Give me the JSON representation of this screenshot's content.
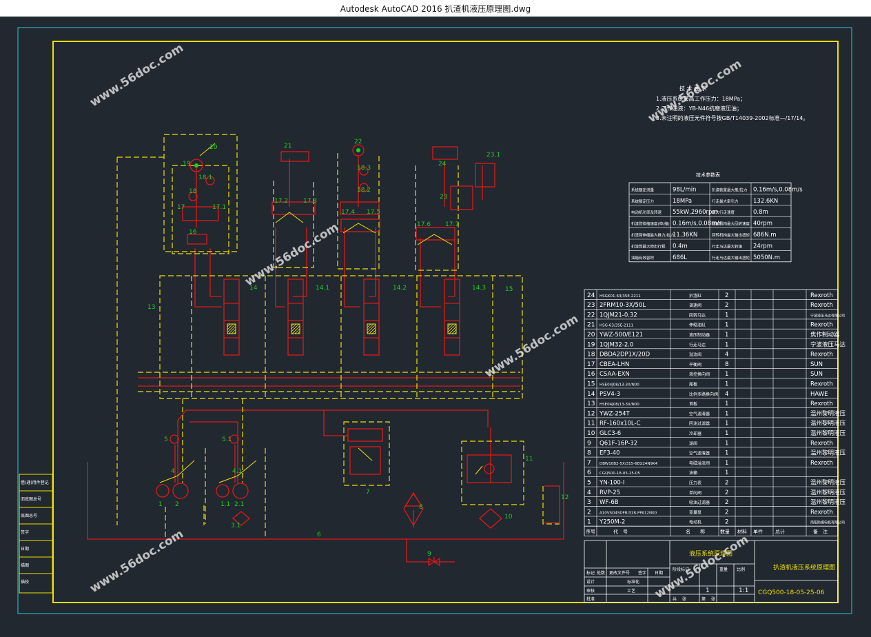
{
  "window": {
    "title": "Autodesk AutoCAD 2016    扒渣机液压原理图.dwg"
  },
  "watermark": "www.56doc.com",
  "callouts": {
    "c20": "20",
    "c19": "19",
    "c18_1": "18.1",
    "c18": "18",
    "c17": "17",
    "c17_1": "17.1",
    "c16": "16",
    "c21": "21",
    "c17_2": "17.2",
    "c17_3": "17.3",
    "c22": "22",
    "c18_3": "18.3",
    "c18_2": "18.2",
    "c17_4": "17.4",
    "c17_5": "17.5",
    "c24": "24",
    "c23_1": "23.1",
    "c23": "23",
    "c17_6": "17.6",
    "c17_7": "17.7",
    "c13": "13",
    "c14": "14",
    "c14_1": "14.1",
    "c14_2": "14.2",
    "c14_3": "14.3",
    "c15": "15",
    "c5": "5",
    "c5_1": "5.1",
    "c4": "4",
    "c4_1": "4.1",
    "c1": "1",
    "c2": "2",
    "c1_1": "1.1",
    "c2_1": "2.1",
    "c3_1": "3.1",
    "c6": "6",
    "c7": "7",
    "c8": "8",
    "c9": "9",
    "c10": "10",
    "c11": "11",
    "c12": "12"
  },
  "tech_req": {
    "title": "技 术 要 求",
    "l1": "1.液压系统最高工作压力：18MPa；",
    "l2": "2.工作油液：YB-N46抗磨液压油；",
    "l3": "3.未注明的液压元件符号按GB/T14039-2002标准—/17/14。"
  },
  "param_table": {
    "title": "技术参数表",
    "rows": [
      [
        "系统额定流量",
        "98L/min",
        "扒渣装置最大推/拉力",
        "0.16m/s,0.08m/s"
      ],
      [
        "系统额定压力",
        "18MPa",
        "行走最大牵引力",
        "132.6KN"
      ],
      [
        "电动机功率及转速",
        "55kW,2960rpm",
        "最大行走速度",
        "0.8m"
      ],
      [
        "扒渣臂伸缩速度(伸/缩)",
        "0.16m/s,0.08m/s",
        "回转机构最大回转速度",
        "40rpm"
      ],
      [
        "扒渣臂伸缩最大推力/拉力",
        "11.36KN",
        "回转机构最大输出扭矩",
        "686N.m"
      ],
      [
        "扒渣臂最大伸出行程",
        "0.4m",
        "行走马达最大转速",
        "24rpm"
      ],
      [
        "油箱有效容积",
        "686L",
        "行走马达最大输出扭矩",
        "5050N.m"
      ]
    ]
  },
  "bom": {
    "rows": [
      [
        "24",
        "HSGK01-63/35E-2211",
        "扒渣缸",
        "2",
        "Rexroth"
      ],
      [
        "23",
        "2FRM10-3X/50L",
        "调速阀",
        "2",
        "Rexroth"
      ],
      [
        "22",
        "1QJM21-0.32",
        "回转马达",
        "1",
        "宁波液压马达有限公司"
      ],
      [
        "21",
        "HSG-63/35E-2111",
        "伸缩油缸",
        "1",
        "Rexroth"
      ],
      [
        "20",
        "YWZ-500/E121",
        "液压制动器",
        "1",
        "焦作制动器"
      ],
      [
        "19",
        "1QJM32-2.0",
        "行走马达",
        "1",
        "宁波液压马达"
      ],
      [
        "18",
        "DBDA2DP1X/20D",
        "溢流阀",
        "4",
        "Rexroth"
      ],
      [
        "17",
        "CBEA-LHN",
        "平衡阀",
        "8",
        "SUN"
      ],
      [
        "16",
        "CSAA-EXN",
        "液控换向阀",
        "1",
        "SUN"
      ],
      [
        "15",
        "HSE04J08/13-3X/N00",
        "尾板",
        "1",
        "Rexroth"
      ],
      [
        "14",
        "PSV4-3",
        "比例多路换向阀",
        "4",
        "HAWE"
      ],
      [
        "13",
        "HSE04J08/13-3X/N00",
        "首板",
        "1",
        "Rexroth"
      ],
      [
        "12",
        "YWZ-254T",
        "空气滤清器",
        "1",
        "温州黎明液压"
      ],
      [
        "11",
        "RF-160x10L-C",
        "回油过滤器",
        "1",
        "温州黎明液压"
      ],
      [
        "10",
        "GLC3-6",
        "冷却器",
        "1",
        "温州黎明液压"
      ],
      [
        "9",
        "Q61F-16P-32",
        "球阀",
        "1",
        "Rexroth"
      ],
      [
        "8",
        "EF3-40",
        "空气滤清器",
        "1",
        "温州黎明液压"
      ],
      [
        "7",
        "DBW10B2-5X/315-6EG24N9K4",
        "电磁溢流阀",
        "1",
        "Rexroth"
      ],
      [
        "6",
        "CGQ500-18-05-25-05",
        "油箱",
        "1",
        ""
      ],
      [
        "5",
        "YN-100-I",
        "压力表",
        "2",
        "温州黎明液压"
      ],
      [
        "4",
        "RVP-25",
        "单向阀",
        "2",
        "温州黎明液压"
      ],
      [
        "3",
        "WF-6B",
        "吸油过滤器",
        "2",
        "温州黎明液压"
      ],
      [
        "2",
        "A10VSO45DFR/31R-PPA12N00",
        "变量泵",
        "2",
        "Rexroth"
      ],
      [
        "1",
        "Y250M-2",
        "电动机",
        "2",
        "南阳防爆电机有限公司"
      ]
    ],
    "headers": [
      "序号",
      "代　号",
      "名　　称",
      "数量",
      "材料",
      "单件",
      "总计",
      "备　注"
    ]
  },
  "title_block": {
    "drawing_name": "扒渣机液压系统原理图",
    "left_title": "液压系统原理图",
    "drawing_no": "CGQ500-18-05-25-06",
    "sheet": "1",
    "scale": "1:1",
    "labels": [
      "标记",
      "处数",
      "更改文件号",
      "签字",
      "日期",
      "设计",
      "标准化",
      "审核",
      "工艺",
      "批准",
      "共",
      "张",
      "第",
      "张",
      "阶段标记",
      "重量",
      "比例"
    ]
  },
  "left_strip": [
    "借(通)用件登记",
    "旧底图总号",
    "底图总号",
    "签字",
    "日期",
    "描图",
    "描校"
  ]
}
